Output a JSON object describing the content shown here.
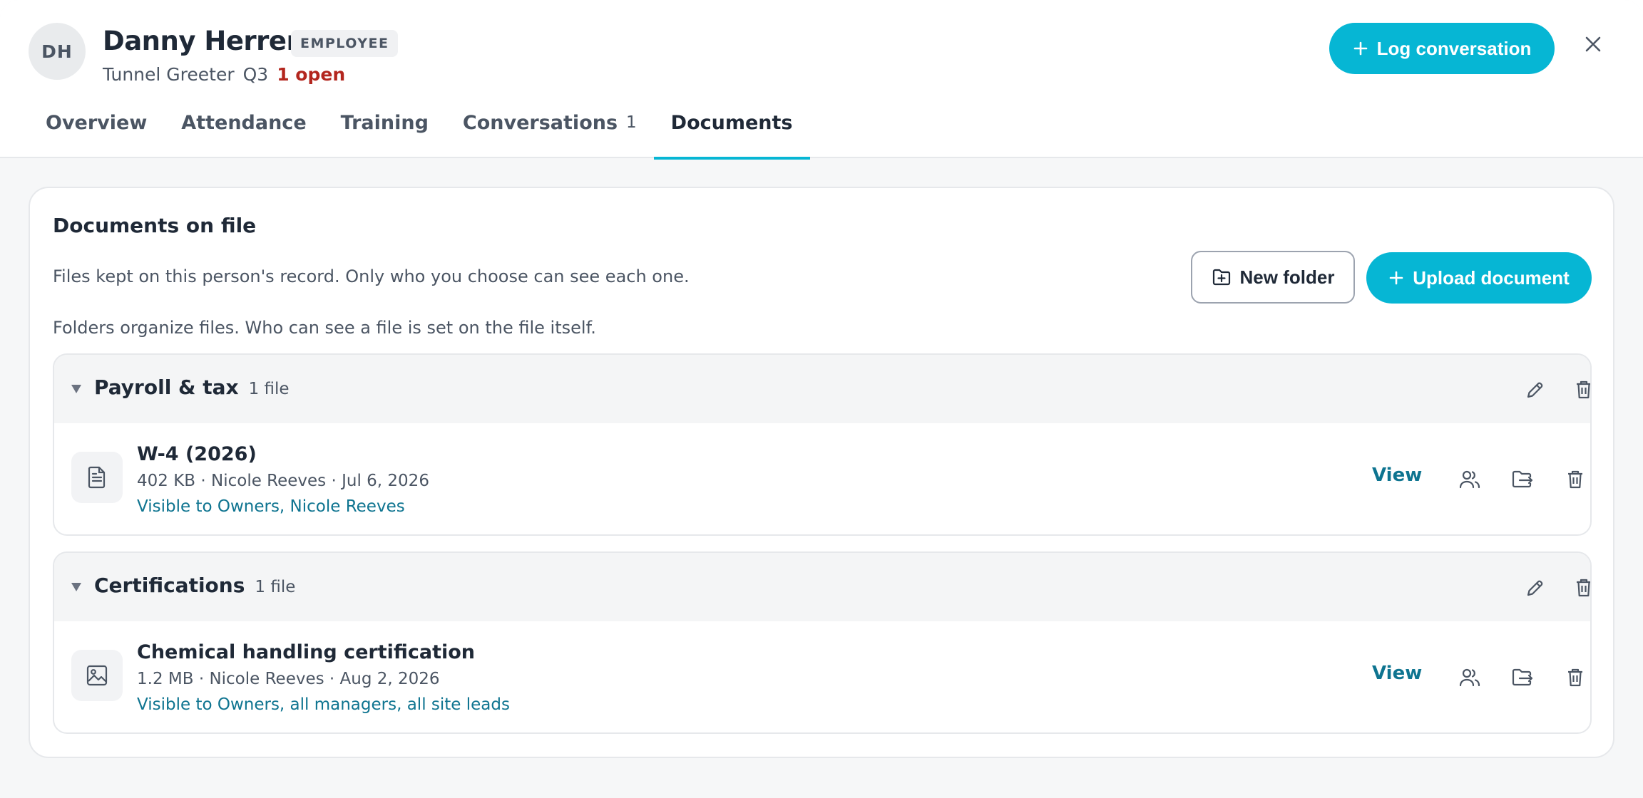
{
  "employee": {
    "initials": "DH",
    "name": "Danny Herrera",
    "role_badge": "EMPLOYEE",
    "title": "Tunnel Greeter",
    "quarter": "Q3",
    "open_items": "1 open"
  },
  "header": {
    "log_conversation_label": "Log conversation"
  },
  "tabs": [
    {
      "label": "Overview"
    },
    {
      "label": "Attendance"
    },
    {
      "label": "Training"
    },
    {
      "label": "Conversations",
      "count": "1"
    },
    {
      "label": "Documents",
      "active": true
    }
  ],
  "documents": {
    "title": "Documents on file",
    "description": "Files kept on this person's record. Only who you choose can see each one.",
    "folder_note": "Folders organize files. Who can see a file is set on the file itself.",
    "new_folder_label": "New folder",
    "upload_label": "Upload document",
    "folders": [
      {
        "name": "Payroll & tax",
        "count": "1 file",
        "files": [
          {
            "name": "W-4 (2026)",
            "meta": "402 KB · Nicole Reeves · Jul 6, 2026",
            "visibility": "Visible to Owners, Nicole Reeves",
            "icon": "document-icon",
            "view_label": "View"
          }
        ]
      },
      {
        "name": "Certifications",
        "count": "1 file",
        "files": [
          {
            "name": "Chemical handling certification",
            "meta": "1.2 MB · Nicole Reeves · Aug 2, 2026",
            "visibility": "Visible to Owners, all managers, all site leads",
            "icon": "image-icon",
            "view_label": "View"
          }
        ]
      }
    ]
  },
  "colors": {
    "accent": "#06b6d4",
    "link": "#0e7490",
    "alert": "#b3261e"
  }
}
